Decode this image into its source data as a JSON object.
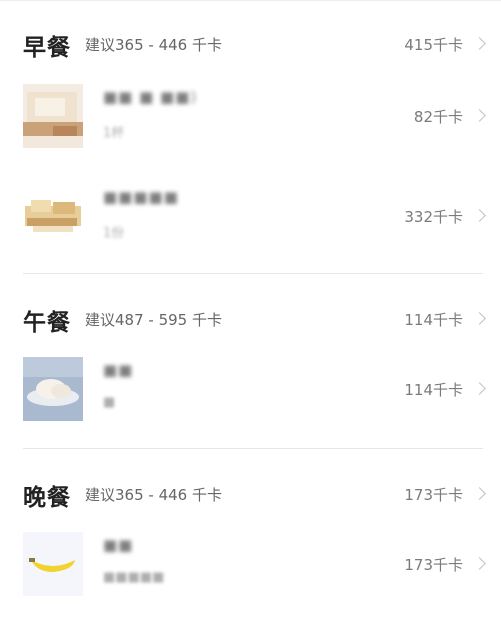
{
  "meals": [
    {
      "title": "早餐",
      "suggest": "建议365 - 446 千卡",
      "total": "415千卡",
      "foods": [
        {
          "name": "■■ ■ ■■)",
          "qty": "1杯",
          "kcal": "82千卡",
          "thumb": "bread-slice"
        },
        {
          "name": "■■■■■",
          "qty": "1份",
          "kcal": "332千卡",
          "thumb": "pastry"
        }
      ]
    },
    {
      "title": "午餐",
      "suggest": "建议487 - 595 千卡",
      "total": "114千卡",
      "foods": [
        {
          "name": "■■",
          "qty": "■",
          "kcal": "114千卡",
          "thumb": "steamed-bun"
        }
      ]
    },
    {
      "title": "晚餐",
      "suggest": "建议365 - 446 千卡",
      "total": "173千卡",
      "foods": [
        {
          "name": "■■",
          "qty": "■■■■■",
          "kcal": "173千卡",
          "thumb": "banana"
        }
      ]
    }
  ],
  "colors": {
    "divider": "#e6e6e6",
    "muted": "#7a7a7a",
    "title": "#222222"
  }
}
